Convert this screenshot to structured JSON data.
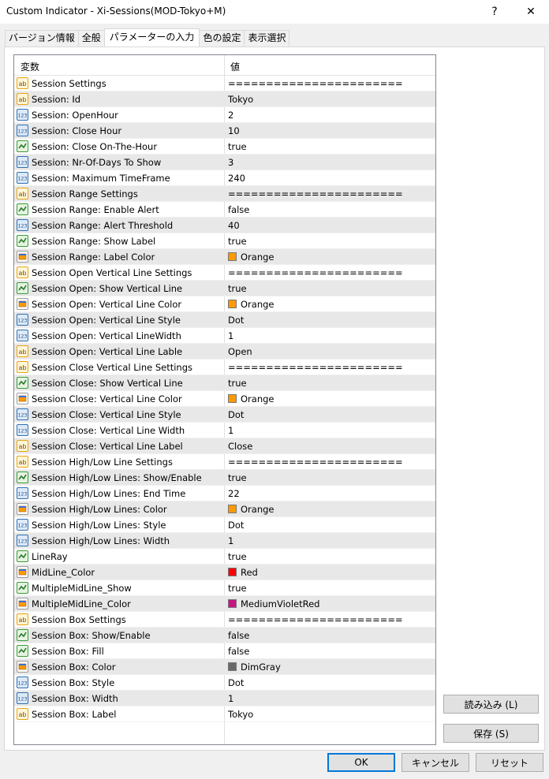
{
  "window": {
    "title": "Custom Indicator - Xi-Sessions(MOD-Tokyo+M)",
    "help_label": "?",
    "close_label": "✕"
  },
  "tabs": [
    "バージョン情報",
    "全般",
    "パラメーターの入力",
    "色の設定",
    "表示選択"
  ],
  "grid": {
    "col_variable": "変数",
    "col_value": "値",
    "rows": [
      {
        "icon": "ab",
        "name": "Session Settings",
        "value": "======================="
      },
      {
        "icon": "ab",
        "name": "Session: Id",
        "value": "Tokyo"
      },
      {
        "icon": "123",
        "name": "Session: OpenHour",
        "value": "2"
      },
      {
        "icon": "123",
        "name": "Session: Close Hour",
        "value": "10"
      },
      {
        "icon": "bool",
        "name": "Session: Close On-The-Hour",
        "value": "true"
      },
      {
        "icon": "123",
        "name": "Session: Nr-Of-Days To Show",
        "value": "3"
      },
      {
        "icon": "123",
        "name": "Session: Maximum TimeFrame",
        "value": "240"
      },
      {
        "icon": "ab",
        "name": "Session Range Settings",
        "value": "======================="
      },
      {
        "icon": "bool",
        "name": "Session Range: Enable Alert",
        "value": "false"
      },
      {
        "icon": "123",
        "name": "Session Range: Alert Threshold",
        "value": "40"
      },
      {
        "icon": "bool",
        "name": "Session Range: Show Label",
        "value": "true"
      },
      {
        "icon": "color",
        "name": "Session Range: Label Color",
        "value": "Orange",
        "swatch": "#ff9900"
      },
      {
        "icon": "ab",
        "name": "Session Open Vertical Line Settings",
        "value": "======================="
      },
      {
        "icon": "bool",
        "name": "Session Open: Show Vertical Line",
        "value": "true"
      },
      {
        "icon": "color",
        "name": "Session Open: Vertical Line Color",
        "value": "Orange",
        "swatch": "#ff9900"
      },
      {
        "icon": "123",
        "name": "Session Open: Vertical Line Style",
        "value": "Dot"
      },
      {
        "icon": "123",
        "name": "Session Open: Vertical LineWidth",
        "value": "1"
      },
      {
        "icon": "ab",
        "name": "Session Open: Vertical Line Lable",
        "value": "Open"
      },
      {
        "icon": "ab",
        "name": "Session Close Vertical Line Settings",
        "value": "======================="
      },
      {
        "icon": "bool",
        "name": "Session Close: Show Vertical Line",
        "value": "true"
      },
      {
        "icon": "color",
        "name": "Session Close: Vertical Line Color",
        "value": "Orange",
        "swatch": "#ff9900"
      },
      {
        "icon": "123",
        "name": "Session Close: Vertical Line Style",
        "value": "Dot"
      },
      {
        "icon": "123",
        "name": "Session Close: Vertical Line Width",
        "value": "1"
      },
      {
        "icon": "ab",
        "name": "Session Close: Vertical Line Label",
        "value": "Close"
      },
      {
        "icon": "ab",
        "name": "Session High/Low Line Settings",
        "value": "======================="
      },
      {
        "icon": "bool",
        "name": "Session High/Low Lines: Show/Enable",
        "value": "true"
      },
      {
        "icon": "123",
        "name": "Session High/Low Lines: End Time",
        "value": "22"
      },
      {
        "icon": "color",
        "name": "Session High/Low Lines: Color",
        "value": "Orange",
        "swatch": "#ff9900"
      },
      {
        "icon": "123",
        "name": "Session High/Low Lines: Style",
        "value": "Dot"
      },
      {
        "icon": "123",
        "name": "Session High/Low Lines:  Width",
        "value": "1"
      },
      {
        "icon": "bool",
        "name": "LineRay",
        "value": "true"
      },
      {
        "icon": "color",
        "name": "MidLine_Color",
        "value": "Red",
        "swatch": "#ff0000"
      },
      {
        "icon": "bool",
        "name": "MultipleMidLine_Show",
        "value": "true"
      },
      {
        "icon": "color",
        "name": "MultipleMidLine_Color",
        "value": "MediumVioletRed",
        "swatch": "#c71585"
      },
      {
        "icon": "ab",
        "name": "Session Box Settings",
        "value": "======================="
      },
      {
        "icon": "bool",
        "name": "Session Box: Show/Enable",
        "value": "false"
      },
      {
        "icon": "bool",
        "name": "Session Box: Fill",
        "value": "false"
      },
      {
        "icon": "color",
        "name": "Session Box: Color",
        "value": "DimGray",
        "swatch": "#696969"
      },
      {
        "icon": "123",
        "name": "Session Box: Style",
        "value": "Dot"
      },
      {
        "icon": "123",
        "name": "Session Box: Width",
        "value": "1"
      },
      {
        "icon": "ab",
        "name": "Session Box: Label",
        "value": "Tokyo"
      }
    ]
  },
  "buttons": {
    "load": "読み込み (L)",
    "save": "保存 (S)",
    "ok": "OK",
    "cancel": "キャンセル",
    "reset": "リセット"
  },
  "colors": {
    "ab_icon": "#e8a317",
    "num_icon": "#2f6fb3",
    "bool_icon": "#3a9a3a"
  }
}
